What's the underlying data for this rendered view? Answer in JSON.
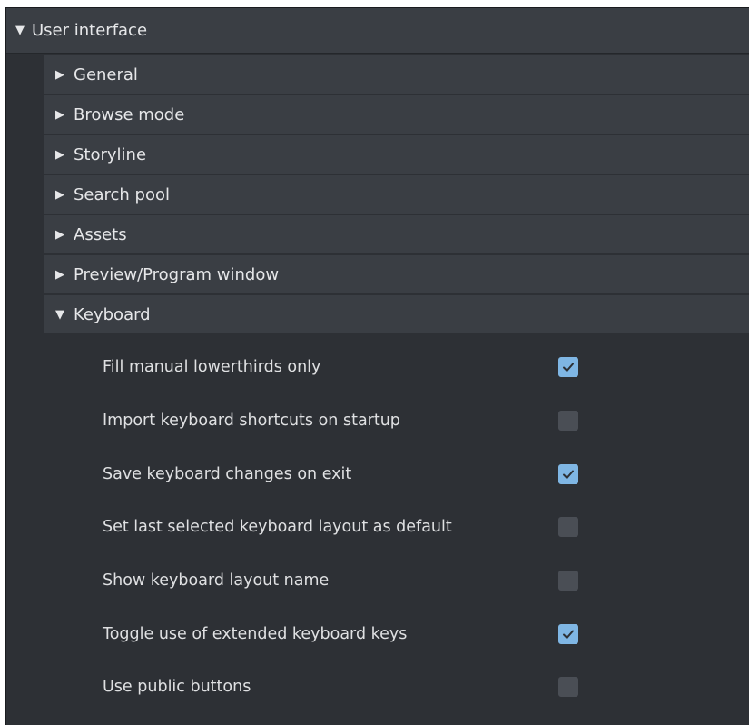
{
  "colors": {
    "panel_background": "#2d3035",
    "header_background": "#3a3e44",
    "text": "#e6e7e9",
    "checkbox_checked": "#7fb6e4",
    "checkbox_unchecked": "#4a4e55"
  },
  "section": {
    "arrow_icon": "triangle-down-icon",
    "title": "User interface"
  },
  "subsections": [
    {
      "label": "General",
      "expanded": false
    },
    {
      "label": "Browse mode",
      "expanded": false
    },
    {
      "label": "Storyline",
      "expanded": false
    },
    {
      "label": "Search pool",
      "expanded": false
    },
    {
      "label": "Assets",
      "expanded": false
    },
    {
      "label": "Preview/Program window",
      "expanded": false
    },
    {
      "label": "Keyboard",
      "expanded": true
    }
  ],
  "keyboard_options": [
    {
      "label": "Fill manual lowerthirds only",
      "checked": true
    },
    {
      "label": "Import keyboard shortcuts on startup",
      "checked": false
    },
    {
      "label": "Save keyboard changes on exit",
      "checked": true
    },
    {
      "label": "Set last selected keyboard layout as default",
      "checked": false
    },
    {
      "label": "Show keyboard layout name",
      "checked": false
    },
    {
      "label": "Toggle use of extended keyboard keys",
      "checked": true
    },
    {
      "label": "Use public buttons",
      "checked": false
    }
  ]
}
